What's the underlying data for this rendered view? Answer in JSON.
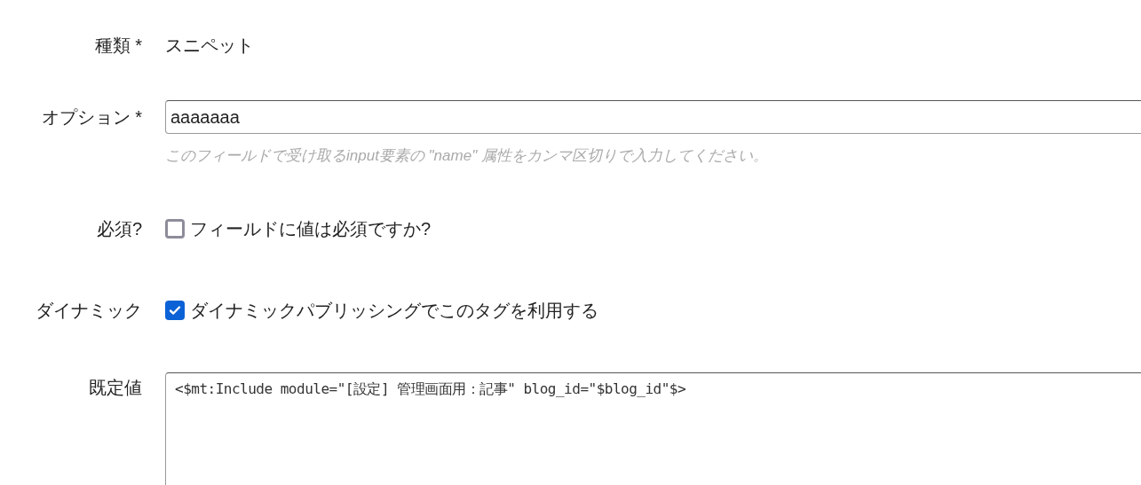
{
  "fields": [
    {
      "kind": "static",
      "label": "種類 *",
      "value": "スニペット"
    },
    {
      "kind": "input",
      "label": "オプション *",
      "value": "aaaaaaa",
      "hint": "このフィールドで受け取るinput要素の \"name\" 属性をカンマ区切りで入力してください。"
    },
    {
      "kind": "checkbox",
      "label": "必須?",
      "text": "フィールドに値は必須ですか?",
      "checked": false
    },
    {
      "kind": "checkbox",
      "label": "ダイナミック",
      "text": "ダイナミックパブリッシングでこのタグを利用する",
      "checked": true
    },
    {
      "kind": "textarea",
      "label": "既定値",
      "value": "<$mt:Include module=\"[設定] 管理画面用：記事\" blog_id=\"$blog_id\"$>"
    }
  ]
}
